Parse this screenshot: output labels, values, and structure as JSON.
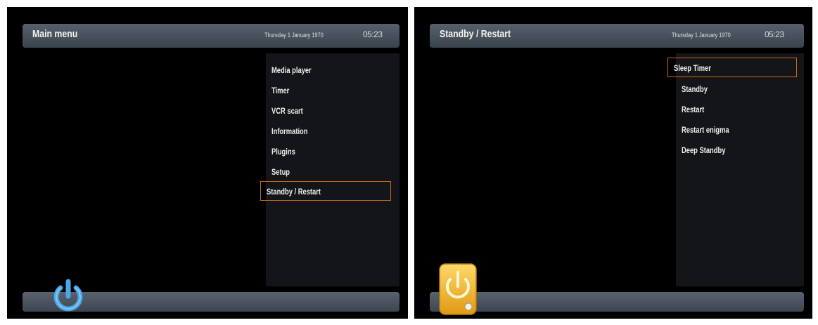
{
  "left_screen": {
    "title": "Main menu",
    "date": "Thursday 1 January 1970",
    "clock": "05:23",
    "menu_items": [
      "Media player",
      "Timer",
      "VCR scart",
      "Information",
      "Plugins",
      "Setup",
      "Standby / Restart"
    ],
    "selected_index": 6,
    "icon": "power-icon-blue"
  },
  "right_screen": {
    "title": "Standby / Restart",
    "date": "Thursday 1 January 1970",
    "clock": "05:23",
    "menu_items": [
      "Sleep Timer",
      "Standby",
      "Restart",
      "Restart enigma",
      "Deep Standby"
    ],
    "selected_index": 0,
    "icon": "power-icon-yellow"
  },
  "colors": {
    "accent": "#c96a1b",
    "bar": "#4a535e",
    "panel": "#141519",
    "power_blue": "#4aa7e6",
    "power_yellow": "#f2b32c"
  }
}
